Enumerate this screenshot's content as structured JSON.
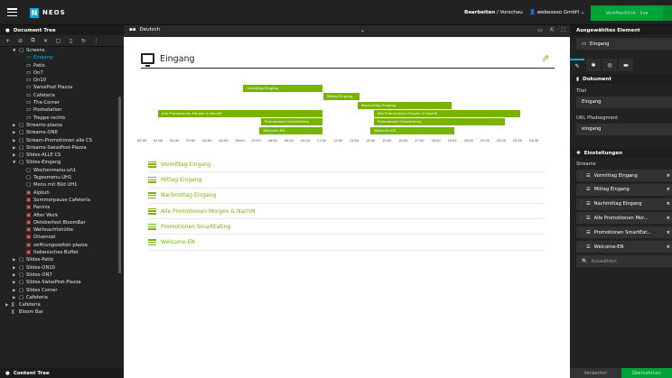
{
  "topbar": {
    "brand": "NEOS",
    "mode_active": "Bearbeiten",
    "mode_sep": " / ",
    "mode_other": "Vorschau",
    "user": "webexeso GmbH",
    "publish_label": "Veröffentlicht - live"
  },
  "left": {
    "title": "Document Tree",
    "content_tree": "Content Tree",
    "tree": [
      {
        "label": "Screens",
        "level": 2,
        "caret": "▼",
        "icon": "▢",
        "sel": false
      },
      {
        "label": "Eingang",
        "level": 3,
        "caret": "",
        "icon": "▭",
        "sel": true
      },
      {
        "label": "Patio",
        "level": 3,
        "caret": "",
        "icon": "▭",
        "sel": false
      },
      {
        "label": "On7",
        "level": 3,
        "caret": "",
        "icon": "▭",
        "sel": false
      },
      {
        "label": "On10",
        "level": 3,
        "caret": "",
        "icon": "▭",
        "sel": false
      },
      {
        "label": "SwissPost Piazza",
        "level": 3,
        "caret": "",
        "icon": "▭",
        "sel": false
      },
      {
        "label": "Cafeteria",
        "level": 3,
        "caret": "",
        "icon": "▭",
        "sel": false
      },
      {
        "label": "The-Corner",
        "level": 3,
        "caret": "",
        "icon": "▭",
        "sel": false
      },
      {
        "label": "Postsstation",
        "level": 3,
        "caret": "",
        "icon": "▭",
        "sel": false
      },
      {
        "label": "Treppe rechts",
        "level": 3,
        "caret": "",
        "icon": "▭",
        "sel": false
      },
      {
        "label": "Streams-piazza",
        "level": 2,
        "caret": "▶",
        "icon": "▢",
        "sel": false
      },
      {
        "label": "Streams-ON6",
        "level": 2,
        "caret": "▶",
        "icon": "▢",
        "sel": false
      },
      {
        "label": "Stream-Promotionen alle CS",
        "level": 2,
        "caret": "▶",
        "icon": "▢",
        "sel": false
      },
      {
        "label": "Streams-SwissPost-Piazza",
        "level": 2,
        "caret": "▶",
        "icon": "▢",
        "sel": false
      },
      {
        "label": "Slides-ALLE CS",
        "level": 2,
        "caret": "▶",
        "icon": "▢",
        "sel": false
      },
      {
        "label": "Slides-Eingang",
        "level": 2,
        "caret": "▼",
        "icon": "▢",
        "sel": false
      },
      {
        "label": "Wochenmenu-uh1",
        "level": 3,
        "caret": "",
        "icon": "▢",
        "sel": false
      },
      {
        "label": "Tagesmenu-UH1",
        "level": 3,
        "caret": "",
        "icon": "▢",
        "sel": false
      },
      {
        "label": "Menu mit Bild UH1",
        "level": 3,
        "caret": "",
        "icon": "▢",
        "sel": false
      },
      {
        "label": "Alpkuh",
        "level": 3,
        "caret": "",
        "icon": "▣",
        "sel": false,
        "red": true
      },
      {
        "label": "Sommerpause Cafeteria",
        "level": 3,
        "caret": "",
        "icon": "▣",
        "sel": false,
        "red": true
      },
      {
        "label": "Paninis",
        "level": 3,
        "caret": "",
        "icon": "▣",
        "sel": false,
        "red": true
      },
      {
        "label": "After Work",
        "level": 3,
        "caret": "",
        "icon": "▣",
        "sel": false,
        "red": true
      },
      {
        "label": "Oktoberfest BloomBar",
        "level": 3,
        "caret": "",
        "icon": "▣",
        "sel": false,
        "red": true
      },
      {
        "label": "Weihnachtshütte",
        "level": 3,
        "caret": "",
        "icon": "▣",
        "sel": false,
        "red": true
      },
      {
        "label": "Olivenoel",
        "level": 3,
        "caret": "",
        "icon": "▣",
        "sel": false,
        "red": true
      },
      {
        "label": "oeffnungszeiten piazza",
        "level": 3,
        "caret": "",
        "icon": "▣",
        "sel": false,
        "red": true
      },
      {
        "label": "Italienisches Buffet",
        "level": 3,
        "caret": "",
        "icon": "▣",
        "sel": false,
        "red": true
      },
      {
        "label": "Slides-Patio",
        "level": 2,
        "caret": "▶",
        "icon": "▢",
        "sel": false
      },
      {
        "label": "Slides-ON10",
        "level": 2,
        "caret": "▶",
        "icon": "▢",
        "sel": false
      },
      {
        "label": "Slides-ON7",
        "level": 2,
        "caret": "▶",
        "icon": "▢",
        "sel": false
      },
      {
        "label": "Slides-SwissPost-Piazza",
        "level": 2,
        "caret": "▶",
        "icon": "▢",
        "sel": false
      },
      {
        "label": "Slides Corner",
        "level": 2,
        "caret": "▶",
        "icon": "▢",
        "sel": false
      },
      {
        "label": "Cafeteria",
        "level": 2,
        "caret": "▶",
        "icon": "▢",
        "sel": false
      },
      {
        "label": "Cafeteria",
        "level": 1,
        "caret": "▶",
        "icon": "ǁ",
        "sel": false
      },
      {
        "label": "Bloom Bar",
        "level": 1,
        "caret": "",
        "icon": "ǁ",
        "sel": false
      }
    ]
  },
  "editbar": {
    "dimension": "Deutsch"
  },
  "page": {
    "title": "Eingang",
    "streams": [
      "Vormittag Eingang",
      "Mittag Eingang",
      "Nachmittag Eingang",
      "Alle Promotionen Morgen & NachM",
      "Promotionen SmartEating",
      "Welcome-EN"
    ]
  },
  "chart_data": {
    "type": "gantt",
    "ticks": [
      "00:00",
      "01:00",
      "02:00",
      "03:00",
      "04:00",
      "05:00",
      "06:00",
      "07:00",
      "08:00",
      "09:00",
      "10:00",
      "11:00",
      "12:00",
      "13:00",
      "14:00",
      "15:00",
      "16:00",
      "17:00",
      "18:00",
      "19:00",
      "20:00",
      "21:00",
      "22:00",
      "23:00",
      "24:00"
    ],
    "bars": [
      {
        "label": "Vormittag Eingang",
        "start": 6.2,
        "end": 11.1,
        "row": 0
      },
      {
        "label": "Mittag Eingang",
        "start": 11.1,
        "end": 13.4,
        "row": 1
      },
      {
        "label": "Nachmittag Eingang",
        "start": 13.2,
        "end": 19.0,
        "row": 2
      },
      {
        "label": "Alle Promotionen Morgen & NachM",
        "start": 1.0,
        "end": 11.1,
        "row": 3
      },
      {
        "label": "Alle Promotionen Morgen & NachM",
        "start": 14.2,
        "end": 23.2,
        "row": 3
      },
      {
        "label": "Promotionen SmartEating",
        "start": 7.3,
        "end": 11.1,
        "row": 4
      },
      {
        "label": "Promotionen SmartEating",
        "start": 14.2,
        "end": 22.3,
        "row": 4
      },
      {
        "label": "Welcome-EN",
        "start": 7.2,
        "end": 11.1,
        "row": 5
      },
      {
        "label": "Welcome-EN",
        "start": 14.0,
        "end": 19.2,
        "row": 5
      }
    ]
  },
  "right": {
    "title": "Ausgewähltes Element",
    "selected": "Eingang",
    "section_document": "Dokument",
    "title_label": "Titel",
    "title_value": "Eingang",
    "urlpath_label": "URL Pfadsegment",
    "urlpath_value": "eingang",
    "section_settings": "Einstellungen",
    "streams_label": "Streams",
    "streams": [
      "Vormittag Eingang",
      "Mittag Eingang",
      "Nachmittag Eingang",
      "Alle Promotionen Mor...",
      "Promotionen SmartEat...",
      "Welcome-EN"
    ],
    "search_placeholder": "Auswählen",
    "discard": "Verwerfen",
    "apply": "Übernehmen"
  }
}
